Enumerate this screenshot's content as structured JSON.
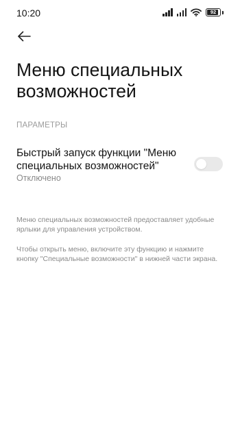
{
  "status_bar": {
    "time": "10:20",
    "battery": "92",
    "battery_level": 0.92,
    "icons": [
      "signal-icon",
      "signal-icon",
      "wifi-icon",
      "battery-icon"
    ]
  },
  "header": {
    "back_icon": "arrow-left-icon",
    "title": "Меню специальных возможностей"
  },
  "section": {
    "header": "ПАРАМЕТРЫ",
    "setting": {
      "title": "Быстрый запуск функции \"Меню специальных возможностей\"",
      "status": "Отключено",
      "enabled": false
    }
  },
  "descriptions": [
    "Меню специальных возможностей предоставляет удобные ярлыки для управления устройством.",
    "Чтобы открыть меню, включите эту функцию и нажмите кнопку \"Специальные возможности\" в нижней части экрана."
  ],
  "colors": {
    "text_primary": "#141414",
    "text_secondary": "#8a8a8a",
    "toggle_off": "#e9e9e9"
  }
}
